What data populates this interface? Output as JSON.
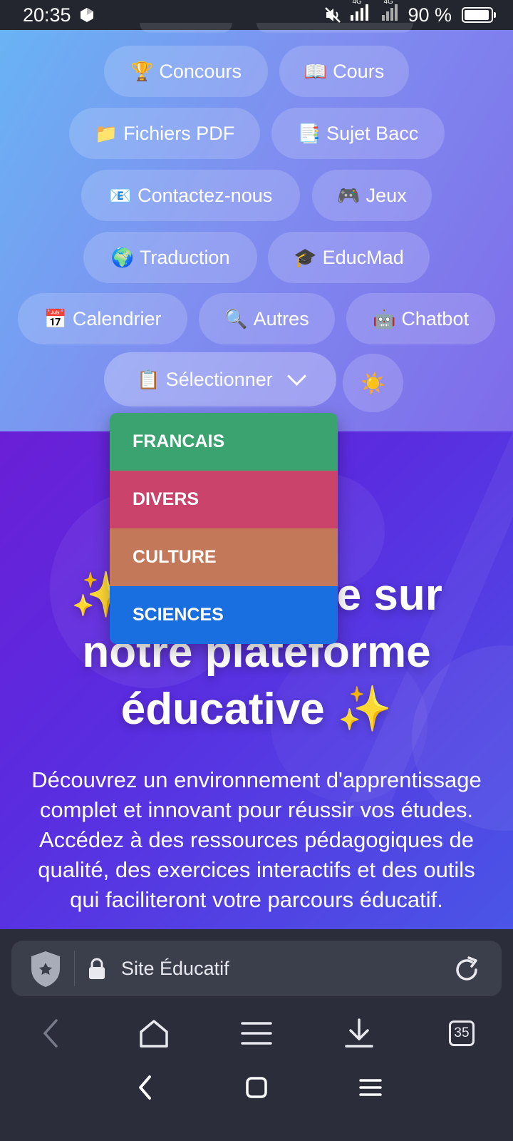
{
  "status": {
    "time": "20:35",
    "network": "4G",
    "battery": "90 %",
    "battery_level": 0.9
  },
  "nav": {
    "pills": [
      {
        "emoji": "🏆",
        "label": "Concours"
      },
      {
        "emoji": "📖",
        "label": "Cours"
      },
      {
        "emoji": "📁",
        "label": "Fichiers PDF"
      },
      {
        "emoji": "📑",
        "label": "Sujet Bacc"
      },
      {
        "emoji": "📧",
        "label": "Contactez-nous"
      },
      {
        "emoji": "🎮",
        "label": "Jeux"
      },
      {
        "emoji": "🌍",
        "label": "Traduction"
      },
      {
        "emoji": "🎓",
        "label": "EducMad"
      },
      {
        "emoji": "📅",
        "label": "Calendrier"
      },
      {
        "emoji": "🔍",
        "label": "Autres"
      },
      {
        "emoji": "🤖",
        "label": "Chatbot"
      }
    ],
    "select": {
      "emoji": "📋",
      "label": "Sélectionner"
    },
    "theme_toggle": "☀️"
  },
  "dropdown": {
    "items": [
      {
        "label": "FRANCAIS",
        "color": "#3aa370"
      },
      {
        "label": "DIVERS",
        "color": "#c9436b"
      },
      {
        "label": "CULTURE",
        "color": "#c4785a"
      },
      {
        "label": "SCIENCES",
        "color": "#1a6fe0"
      }
    ]
  },
  "hero": {
    "title_line1": "✨ Bienvenue sur",
    "title_line2": "notre plateforme",
    "title_line3": "éducative ✨",
    "text": "Découvrez un environnement d'apprentissage complet et innovant pour réussir vos études. Accédez à des ressources pédagogiques de qualité, des exercices interactifs et des outils qui faciliteront votre parcours éducatif."
  },
  "browser": {
    "url_text": "Site Éducatif",
    "tabs_count": "35"
  }
}
